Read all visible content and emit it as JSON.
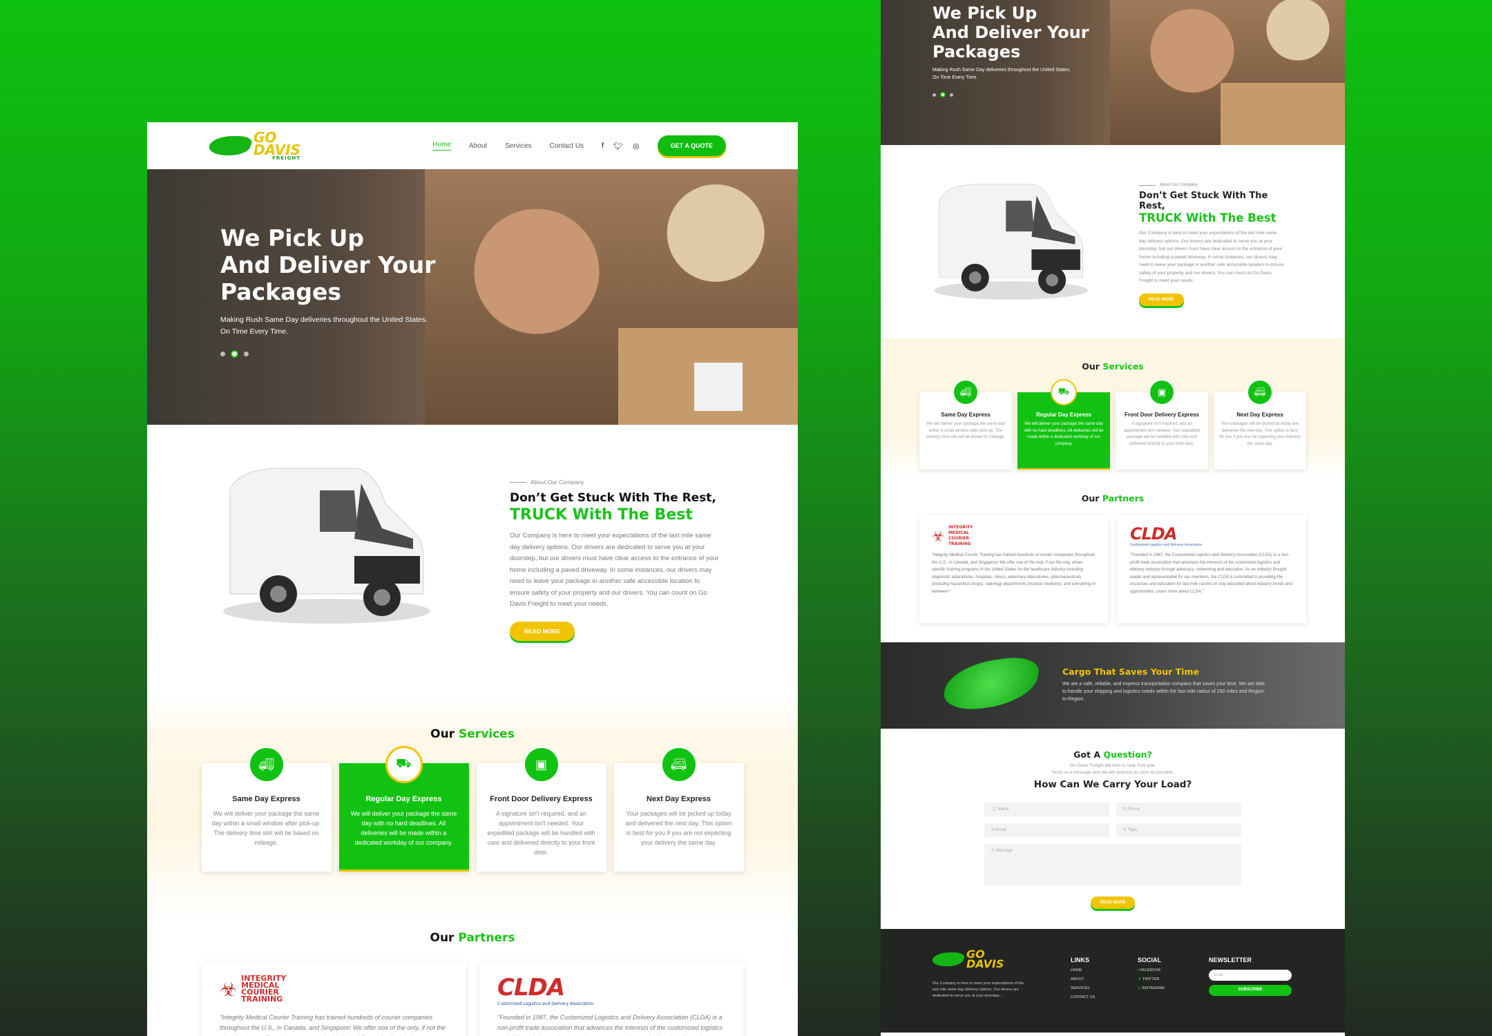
{
  "brand": {
    "logo_go": "GO",
    "logo_davis": "DAVIS",
    "logo_freight": "FREIGHT"
  },
  "nav": {
    "home": "Home",
    "about": "About",
    "services": "Services",
    "contact": "Contact Us",
    "quote": "GET A QUOTE"
  },
  "hero": {
    "title_l1": "We Pick Up",
    "title_l2": "And Deliver Your",
    "title_l3": "Packages",
    "subtitle_l1": "Making Rush Same Day deliveries throughout the United States.",
    "subtitle_l2": "On Time Every Time."
  },
  "about": {
    "eyebrow": "About Our Company",
    "title": "Don’t Get Stuck With The Rest,",
    "title_accent": "TRUCK With The Best",
    "body": "Our Company is here to meet your expectations of the last mile same day delivery options. Our drivers are dedicated to serve you at your doorstep, but our drivers must have clear access to the entrance of your home including a paved driveway. In some instances, our drivers may need to leave your package in another safe accessible location to ensure safety of your property and our drivers. You can count on Go Davis Freight to meet your needs.",
    "button": "READ MORE"
  },
  "services": {
    "heading_prefix": "Our",
    "heading_accent": "Services",
    "items": [
      {
        "title": "Same Day Express",
        "desc": "We will deliver your package the same day within a small window after pick-up. The delivery time slot will be based on mileage."
      },
      {
        "title": "Regular Day Express",
        "desc": "We will deliver your package the same day with no hard deadlines. All deliveries will be made within a dedicated workday of our company."
      },
      {
        "title": "Front Door Delivery Express",
        "desc": "A signature isn't required, and an appointment isn't needed. Your expedited package will be handled with care and delivered directly to your front door."
      },
      {
        "title": "Next Day Express",
        "desc": "Your packages will be picked up today and delivered the next day. This option is best for you if you are not expecting your delivery the same day."
      }
    ]
  },
  "partners": {
    "heading_prefix": "Our",
    "heading_accent": "Partners",
    "imct_logo": "INTEGRITY MEDICAL COURIER TRAINING",
    "imct_quote": "\"Integrity Medical Courier Training has trained hundreds of courier companies throughout the U.S., in Canada, and Singapore! We offer one of the only, if not the only, driver-specific training programs in the United States for the healthcare industry including diagnostic laboratories, hospitals, clinics, veterinary laboratories, pharmaceuticals (including hazardous drugs), radiology departments (nuclear medicine), and everything in between!\"",
    "clda_logo": "CLDA",
    "clda_sub": "Customized Logistics and Delivery Association",
    "clda_quote": "\"Founded in 1987, the Customized Logistics and Delivery Association (CLDA) is a non-profit trade association that advances the interests of the customized logistics and delivery industry through advocacy, networking and education. As an industry thought leader and representative for our members, the CLDA is committed to providing the resources and education for last mile carriers to stay educated about industry trends and opportunities. Learn more about CLDA.\""
  },
  "cargo": {
    "title_prefix": "Cargo That",
    "title_accent": "Saves",
    "title_suffix": "Your Time",
    "body": "We are a safe, reliable, and express transportation company that saves your time. We are able to handle your shipping and logistics needs within the last mile radius of 150 miles and Region-to-Region."
  },
  "contact": {
    "heading_prefix": "Got A",
    "heading_accent": "Question?",
    "sub_l1": "Go Davis Freight will love to hear from you.",
    "sub_l2": "Send us a message and we will respond as soon as possible.",
    "big": "How Can We Carry Your Load?",
    "name": "Name",
    "phone": "Phone",
    "email": "Email",
    "topic": "Topic",
    "message": "Message",
    "button": "READ MORE"
  },
  "footer": {
    "desc": "Our Company is here to meet your expectations of the last mile same day delivery options. Our drivers are dedicated to serve you at your doorstep...",
    "links_h": "LINKS",
    "links": [
      "HOME",
      "ABOUT",
      "SERVICES",
      "CONTACT US"
    ],
    "social_h": "SOCIAL",
    "social": [
      "FACEBOOK",
      "TWITTER",
      "INSTAGRAM"
    ],
    "news_h": "NEWSLETTER",
    "news_ph": "Email",
    "news_btn": "SUBSCRIBE"
  },
  "colors": {
    "brand_green": "#12c212",
    "accent_yellow": "#f1c400",
    "bg_green": "#0ec010"
  }
}
